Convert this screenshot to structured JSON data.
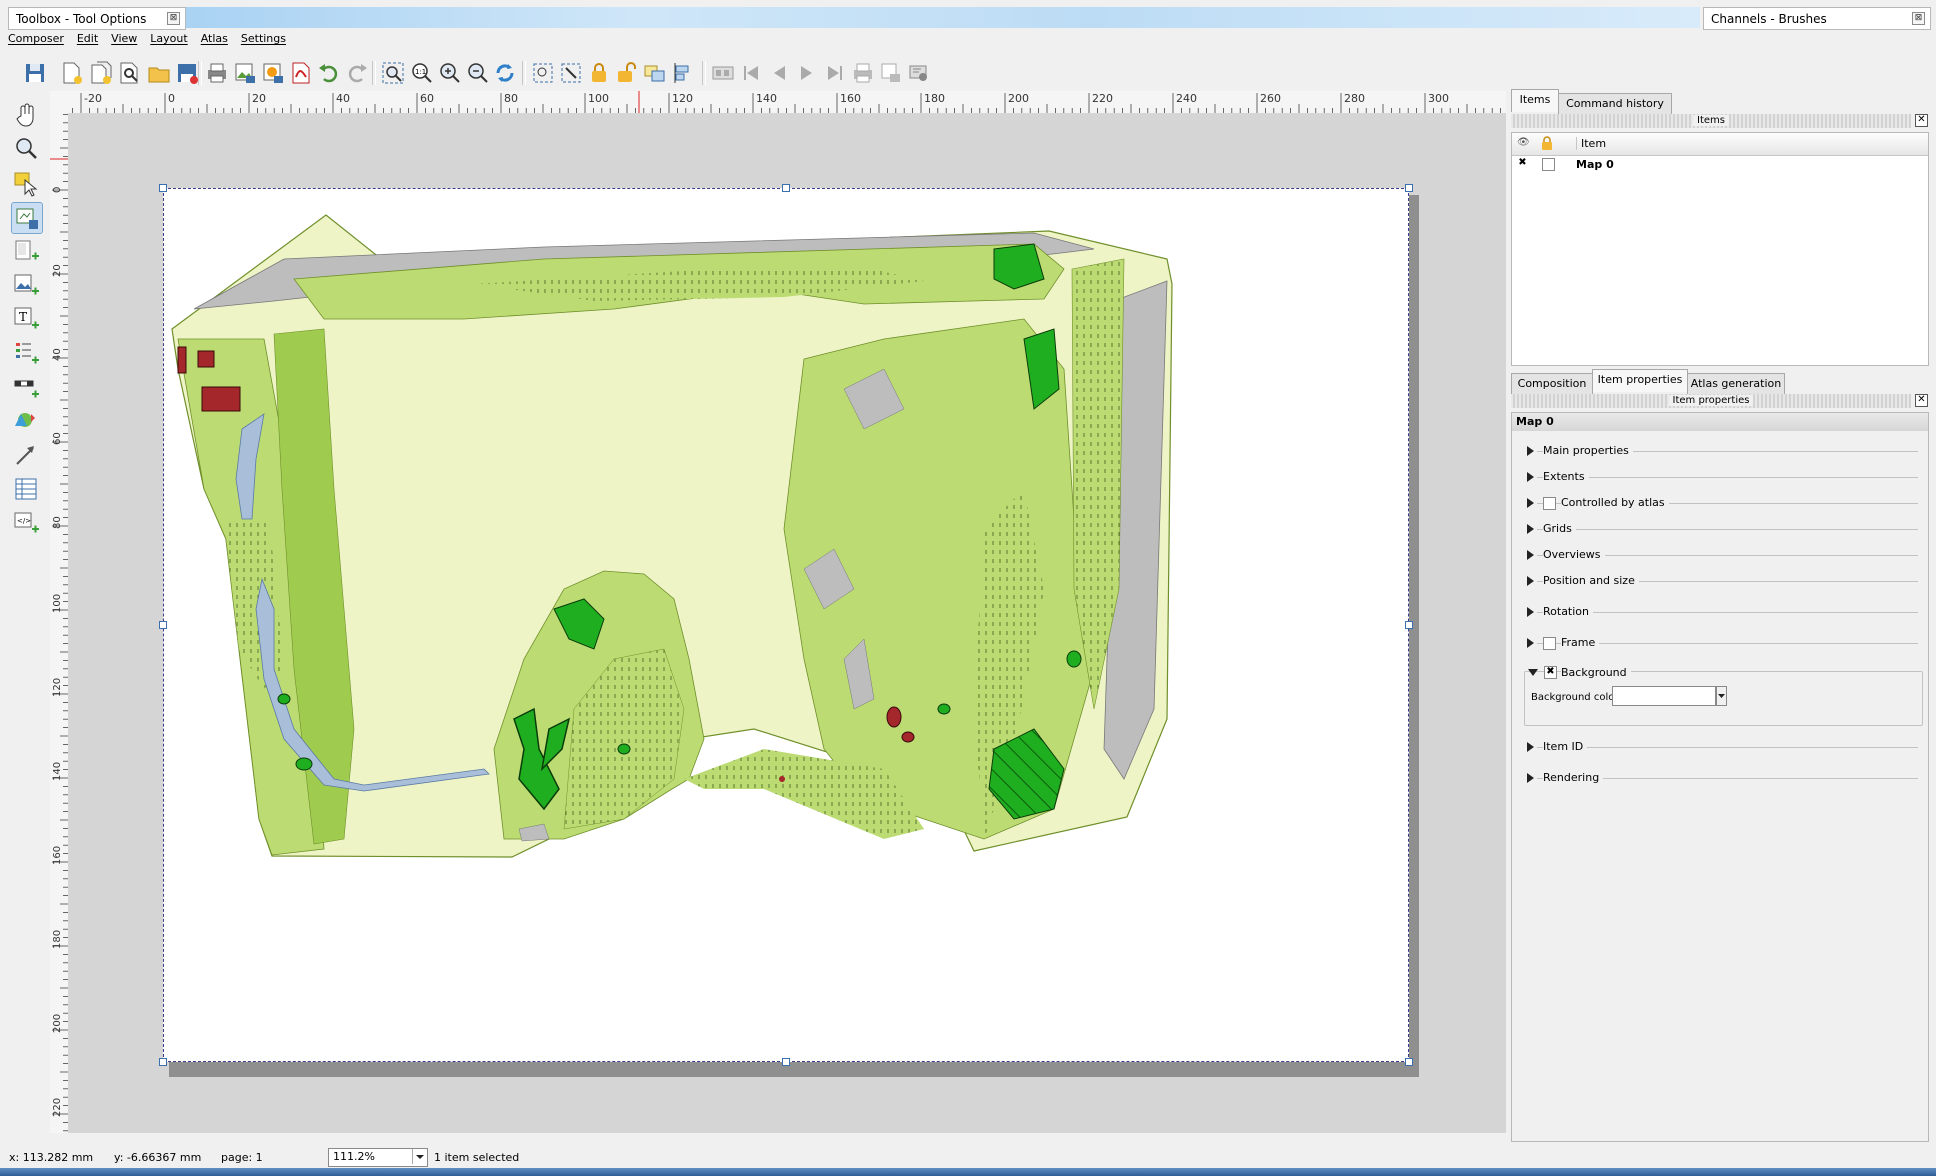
{
  "windows": {
    "toolbox_title": "Toolbox - Tool Options",
    "channels_title": "Channels - Brushes",
    "close_glyph": "⊠"
  },
  "menu": [
    "Composer",
    "Edit",
    "View",
    "Layout",
    "Atlas",
    "Settings"
  ],
  "toolbar_icons": [
    "save-icon",
    "new-composer-icon",
    "duplicate-composer-icon",
    "composer-manager-icon",
    "open-template-icon",
    "save-template-icon",
    "print-icon",
    "export-image-icon",
    "export-svg-icon",
    "export-pdf-icon",
    "undo-icon",
    "redo-icon",
    "zoom-full-icon",
    "zoom-100-icon",
    "zoom-in-icon",
    "zoom-out-icon",
    "refresh-icon",
    "select-all-icon",
    "select-item-icon",
    "lock-icon",
    "unlock-icon",
    "group-icon",
    "align-icon",
    "atlas-preview-icon",
    "first-feature-icon",
    "previous-feature-icon",
    "next-feature-icon",
    "last-feature-icon",
    "atlas-print-icon",
    "atlas-export-icon",
    "atlas-settings-icon"
  ],
  "left_tools": [
    "pan-icon",
    "zoom-tool-icon",
    "select-move-icon",
    "move-content-icon",
    "add-map-icon",
    "add-image-icon",
    "add-label-icon",
    "add-legend-icon",
    "add-scalebar-icon",
    "add-shape-icon",
    "add-arrow-icon",
    "add-table-icon",
    "add-html-icon"
  ],
  "ruler": {
    "h_labels": [
      "-20",
      "0",
      "20",
      "40",
      "60",
      "80",
      "100",
      "120",
      "140",
      "160",
      "180",
      "200",
      "220",
      "240",
      "260",
      "280",
      "300"
    ],
    "v_labels": [
      "0",
      "20",
      "40",
      "60",
      "80",
      "100",
      "120",
      "140",
      "160",
      "180",
      "200",
      "220"
    ]
  },
  "items_panel": {
    "tabs": [
      "Items",
      "Command history"
    ],
    "header": "Items",
    "column": "Item",
    "rows": [
      {
        "name": "Map 0",
        "visible": true,
        "locked": false
      }
    ]
  },
  "properties_panel": {
    "tabs": [
      "Composition",
      "Item properties",
      "Atlas generation"
    ],
    "header": "Item properties",
    "item_name": "Map 0",
    "groups": [
      {
        "label": "Main properties",
        "checkbox": false
      },
      {
        "label": "Extents",
        "checkbox": false
      },
      {
        "label": "Controlled by atlas",
        "checkbox": true,
        "checked": false
      },
      {
        "label": "Grids",
        "checkbox": false
      },
      {
        "label": "Overviews",
        "checkbox": false
      },
      {
        "label": "Position and size",
        "checkbox": false
      },
      {
        "label": "Rotation",
        "checkbox": false
      },
      {
        "label": "Frame",
        "checkbox": true,
        "checked": false
      }
    ],
    "background": {
      "label": "Background",
      "checked": true,
      "color_label": "Background color",
      "color": "#ffffff"
    },
    "after_groups": [
      {
        "label": "Item ID"
      },
      {
        "label": "Rendering"
      }
    ]
  },
  "status": {
    "x": "x: 113.282 mm",
    "y": "y: -6.66367 mm",
    "page": "page: 1",
    "zoom": "111.2%",
    "selection": "1 item selected"
  },
  "map_colors": {
    "pale": "#eef4c6",
    "light_green": "#bcdc73",
    "medium_green": "#9fcc4f",
    "bright_green": "#1fae1f",
    "gray": "#bdbdbd",
    "water": "#a9bfd9",
    "red": "#a3272b"
  }
}
